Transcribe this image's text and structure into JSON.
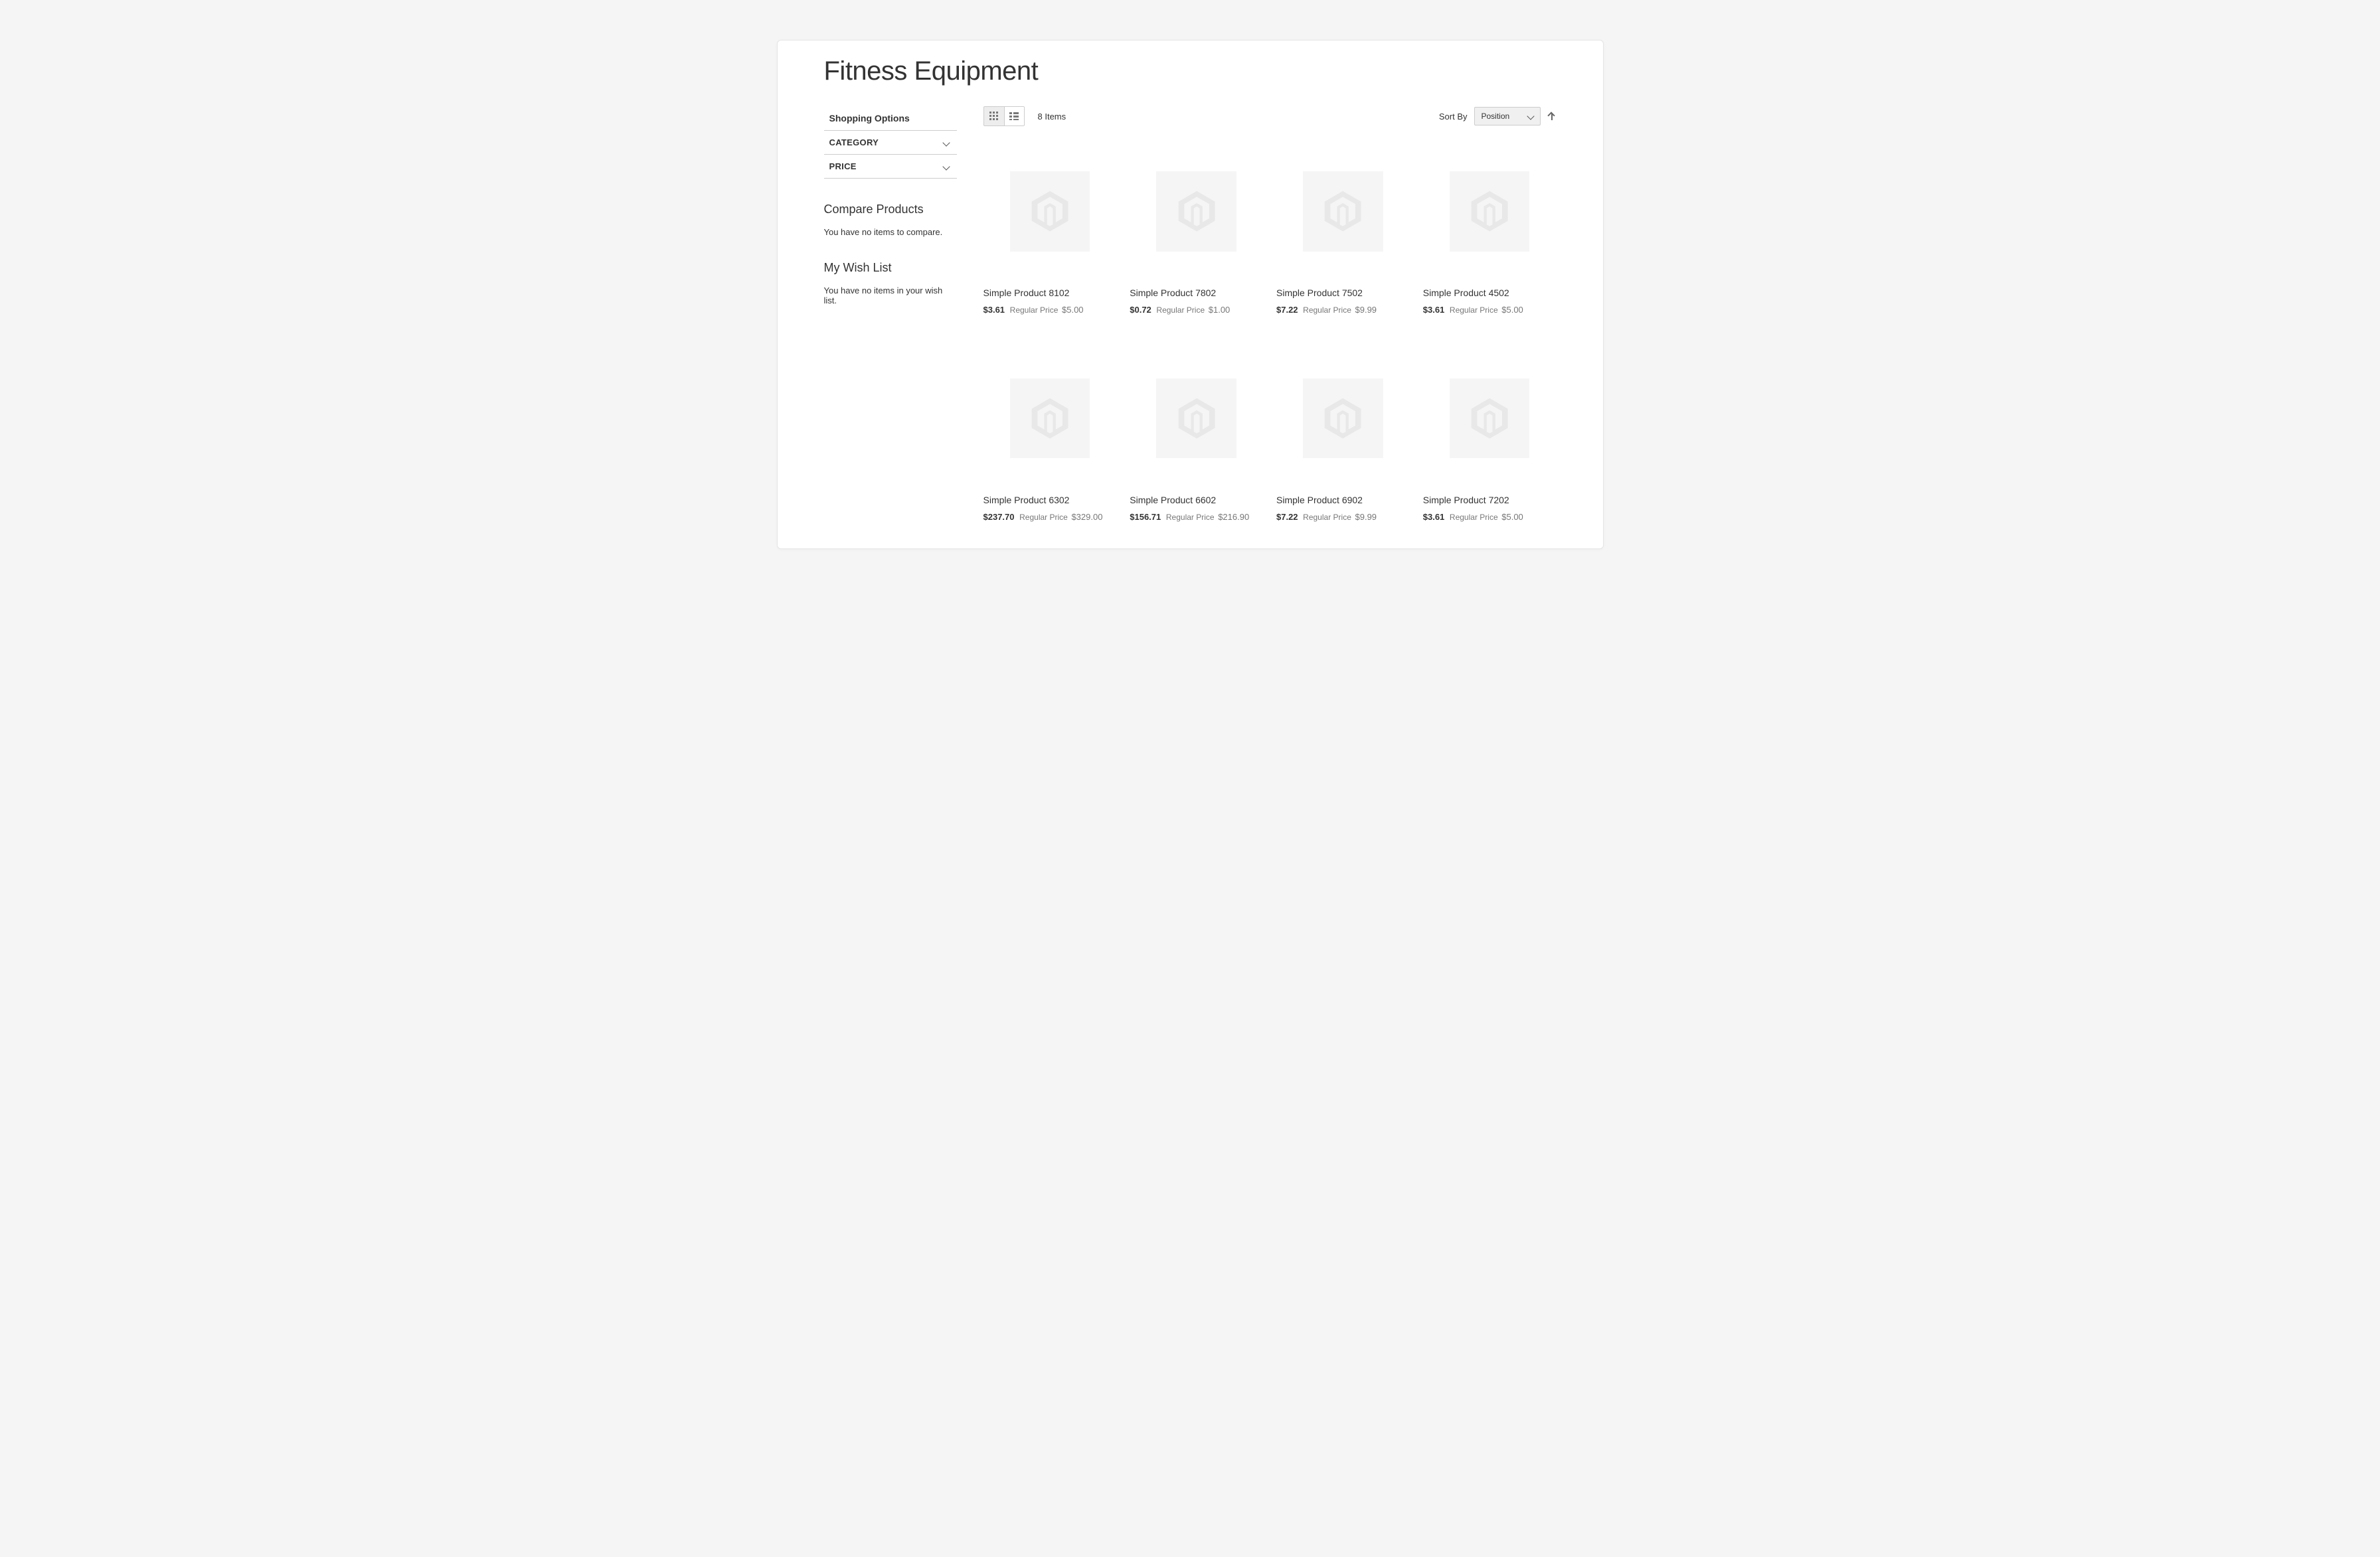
{
  "page_title": "Fitness Equipment",
  "sidebar": {
    "shopping_options_title": "Shopping Options",
    "filters": [
      {
        "label": "CATEGORY"
      },
      {
        "label": "PRICE"
      }
    ],
    "compare": {
      "title": "Compare Products",
      "empty": "You have no items to compare."
    },
    "wishlist": {
      "title": "My Wish List",
      "empty": "You have no items in your wish list."
    }
  },
  "toolbar": {
    "item_count": "8 Items",
    "sort_by_label": "Sort By",
    "sort_selected": "Position"
  },
  "products": [
    {
      "name": "Simple Product 8102",
      "special_price": "$3.61",
      "regular_label": "Regular Price",
      "regular_price": "$5.00"
    },
    {
      "name": "Simple Product 7802",
      "special_price": "$0.72",
      "regular_label": "Regular Price",
      "regular_price": "$1.00"
    },
    {
      "name": "Simple Product 7502",
      "special_price": "$7.22",
      "regular_label": "Regular Price",
      "regular_price": "$9.99"
    },
    {
      "name": "Simple Product 4502",
      "special_price": "$3.61",
      "regular_label": "Regular Price",
      "regular_price": "$5.00"
    },
    {
      "name": "Simple Product 6302",
      "special_price": "$237.70",
      "regular_label": "Regular Price",
      "regular_price": "$329.00"
    },
    {
      "name": "Simple Product 6602",
      "special_price": "$156.71",
      "regular_label": "Regular Price",
      "regular_price": "$216.90"
    },
    {
      "name": "Simple Product 6902",
      "special_price": "$7.22",
      "regular_label": "Regular Price",
      "regular_price": "$9.99"
    },
    {
      "name": "Simple Product 7202",
      "special_price": "$3.61",
      "regular_label": "Regular Price",
      "regular_price": "$5.00"
    }
  ]
}
